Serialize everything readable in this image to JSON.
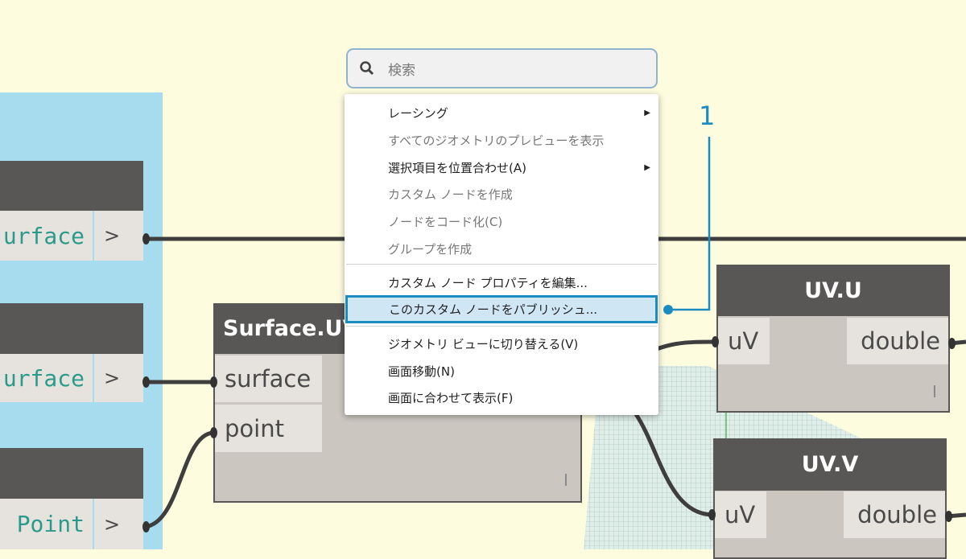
{
  "canvas": {
    "left_nodes": [
      {
        "output_value": "urface",
        "port_label": ">"
      },
      {
        "output_value": "urface",
        "port_label": ">"
      },
      {
        "output_value": "Point",
        "port_label": ">"
      }
    ],
    "surface_uv_node": {
      "title": "Surface.UV",
      "inputs": [
        "surface",
        "point"
      ],
      "footer_mark": "I"
    },
    "uv_u_node": {
      "title": "UV.U",
      "input": "uV",
      "output": "double",
      "footer_mark": "I"
    },
    "uv_v_node": {
      "title": "UV.V",
      "input": "uV",
      "output": "double"
    }
  },
  "context_menu": {
    "search_placeholder": "検索",
    "items": [
      {
        "label": "レーシング",
        "enabled": true,
        "submenu": true
      },
      {
        "label": "すべてのジオメトリのプレビューを表示",
        "enabled": false
      },
      {
        "label": "選択項目を位置合わせ(A)",
        "enabled": true,
        "submenu": true
      },
      {
        "label": "カスタム ノードを作成",
        "enabled": false
      },
      {
        "label": "ノードをコード化(C)",
        "enabled": false
      },
      {
        "label": "グループを作成",
        "enabled": false
      },
      {
        "label": "カスタム ノード プロパティを編集...",
        "enabled": true
      },
      {
        "label": "このカスタム ノードをパブリッシュ...",
        "enabled": true,
        "highlighted": true
      },
      {
        "label": "ジオメトリ ビューに切り替える(V)",
        "enabled": true
      },
      {
        "label": "画面移動(N)",
        "enabled": true
      },
      {
        "label": "画面に合わせて表示(F)",
        "enabled": true
      }
    ],
    "submenu_arrow": "▶"
  },
  "annotation": {
    "number": "1",
    "color": "#1a8cc0"
  },
  "colors": {
    "canvas": "#fdfcdf",
    "group": "#a6dcee",
    "node_header": "#595756",
    "highlight": "#cfe6f5"
  }
}
